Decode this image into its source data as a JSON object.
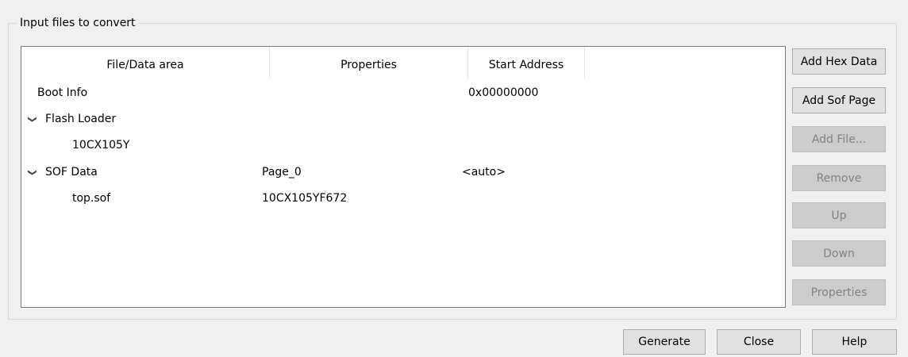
{
  "group": {
    "title": "Input files to convert"
  },
  "table": {
    "columns": [
      "File/Data area",
      "Properties",
      "Start Address"
    ],
    "rows": [
      {
        "name": "Boot Info",
        "properties": "",
        "start_address": "0x00000000",
        "expandable": false,
        "level": 0
      },
      {
        "name": "Flash Loader",
        "properties": "",
        "start_address": "",
        "expandable": true,
        "level": 0
      },
      {
        "name": "10CX105Y",
        "properties": "",
        "start_address": "",
        "expandable": false,
        "level": 1
      },
      {
        "name": "SOF Data",
        "properties": "Page_0",
        "start_address": "<auto>",
        "expandable": true,
        "level": 0
      },
      {
        "name": "top.sof",
        "properties": "10CX105YF672",
        "start_address": "",
        "expandable": false,
        "level": 1
      }
    ]
  },
  "side_buttons": {
    "add_hex_data": {
      "label": "Add Hex Data",
      "enabled": true
    },
    "add_sof_page": {
      "label": "Add Sof Page",
      "enabled": true
    },
    "add_file": {
      "label": "Add File...",
      "enabled": false
    },
    "remove": {
      "label": "Remove",
      "enabled": false
    },
    "up": {
      "label": "Up",
      "enabled": false
    },
    "down": {
      "label": "Down",
      "enabled": false
    },
    "properties": {
      "label": "Properties",
      "enabled": false
    }
  },
  "bottom_buttons": {
    "generate": "Generate",
    "close": "Close",
    "help": "Help"
  },
  "icons": {
    "expand": "chevron-down-icon"
  }
}
